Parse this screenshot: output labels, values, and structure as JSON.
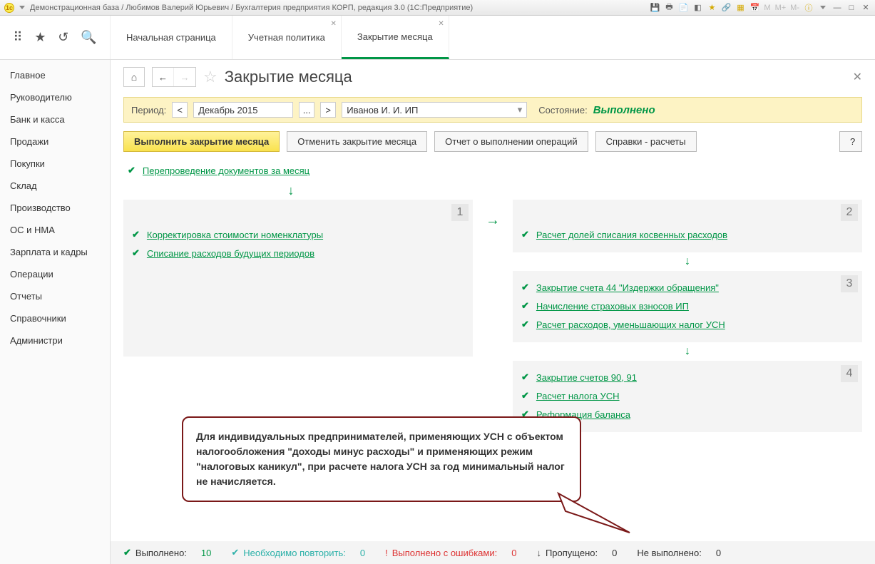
{
  "titlebar": {
    "text": "Демонстрационная база / Любимов Валерий Юрьевич / Бухгалтерия предприятия КОРП, редакция 3.0  (1С:Предприятие)",
    "m_labels": [
      "M",
      "M+",
      "M-"
    ]
  },
  "tabs": {
    "start": "Начальная страница",
    "t1": "Учетная политика",
    "t2": "Закрытие месяца"
  },
  "sidebar": {
    "items": [
      "Главное",
      "Руководителю",
      "Банк и касса",
      "Продажи",
      "Покупки",
      "Склад",
      "Производство",
      "ОС и НМА",
      "Зарплата и кадры",
      "Операции",
      "Отчеты",
      "Справочники",
      "Администри"
    ]
  },
  "page": {
    "title": "Закрытие месяца"
  },
  "period": {
    "label": "Период:",
    "value": "Декабрь 2015",
    "org": "Иванов И. И. ИП",
    "status_label": "Состояние:",
    "status_value": "Выполнено"
  },
  "actions": {
    "run": "Выполнить закрытие месяца",
    "cancel": "Отменить закрытие месяца",
    "report": "Отчет о выполнении операций",
    "refs": "Справки - расчеты",
    "help": "?"
  },
  "ops": {
    "first": "Перепроведение документов за месяц",
    "block1": {
      "num": "1",
      "items": [
        "Корректировка стоимости номенклатуры",
        "Списание расходов будущих периодов"
      ]
    },
    "block2": {
      "num": "2",
      "items": [
        "Расчет долей списания косвенных расходов"
      ]
    },
    "block3": {
      "num": "3",
      "items": [
        "Закрытие счета 44 \"Издержки обращения\"",
        "Начисление страховых взносов ИП",
        "Расчет расходов, уменьшающих налог УСН"
      ]
    },
    "block4": {
      "num": "4",
      "items": [
        "Закрытие счетов 90, 91",
        "Расчет налога УСН",
        "Реформация баланса"
      ]
    }
  },
  "callout": {
    "text": "Для индивидуальных предпринимателей, применяющих УСН с объектом налогообложения \"доходы минус расходы\" и применяющих режим \"налоговых каникул\", при расчете налога УСН за год минимальный налог не начисляется."
  },
  "footer": {
    "done_label": "Выполнено:",
    "done_val": "10",
    "repeat_label": "Необходимо повторить:",
    "repeat_val": "0",
    "err_label": "Выполнено с ошибками:",
    "err_val": "0",
    "skip_label": "Пропущено:",
    "skip_val": "0",
    "notdone_label": "Не выполнено:",
    "notdone_val": "0"
  }
}
